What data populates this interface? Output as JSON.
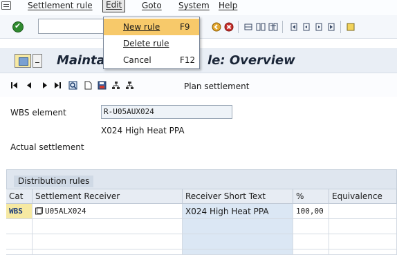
{
  "menubar": {
    "items": [
      "Settlement rule",
      "Edit",
      "Goto",
      "System",
      "Help"
    ]
  },
  "dropdown": {
    "items": [
      {
        "label": "New rule",
        "shortcut": "F9"
      },
      {
        "label": "Delete rule",
        "shortcut": ""
      },
      {
        "label": "Cancel",
        "shortcut": "F12"
      }
    ]
  },
  "title": {
    "left": "Mainta",
    "right": "le: Overview"
  },
  "app_toolbar": {
    "plan_settlement": "Plan settlement"
  },
  "fields": {
    "wbs_label": "WBS element",
    "wbs_value": "R-U05AUX024",
    "wbs_description": "X024 High Heat PPA",
    "actual_settlement_label": "Actual settlement"
  },
  "distribution": {
    "title": "Distribution rules",
    "columns": [
      "Cat",
      "Settlement Receiver",
      "Receiver Short Text",
      "%",
      "Equivalence no."
    ],
    "rows": [
      {
        "cat": "WBS",
        "receiver": "U05ALX024",
        "short_text": "X024 High Heat PPA",
        "percent": "100,00",
        "equivalence": ""
      }
    ]
  },
  "colors": {
    "menu_highlight": "#f7c96a",
    "title_bar": "#e9eef5",
    "table_blue": "#dbe7f4",
    "panel_header": "#dfe6ef"
  }
}
